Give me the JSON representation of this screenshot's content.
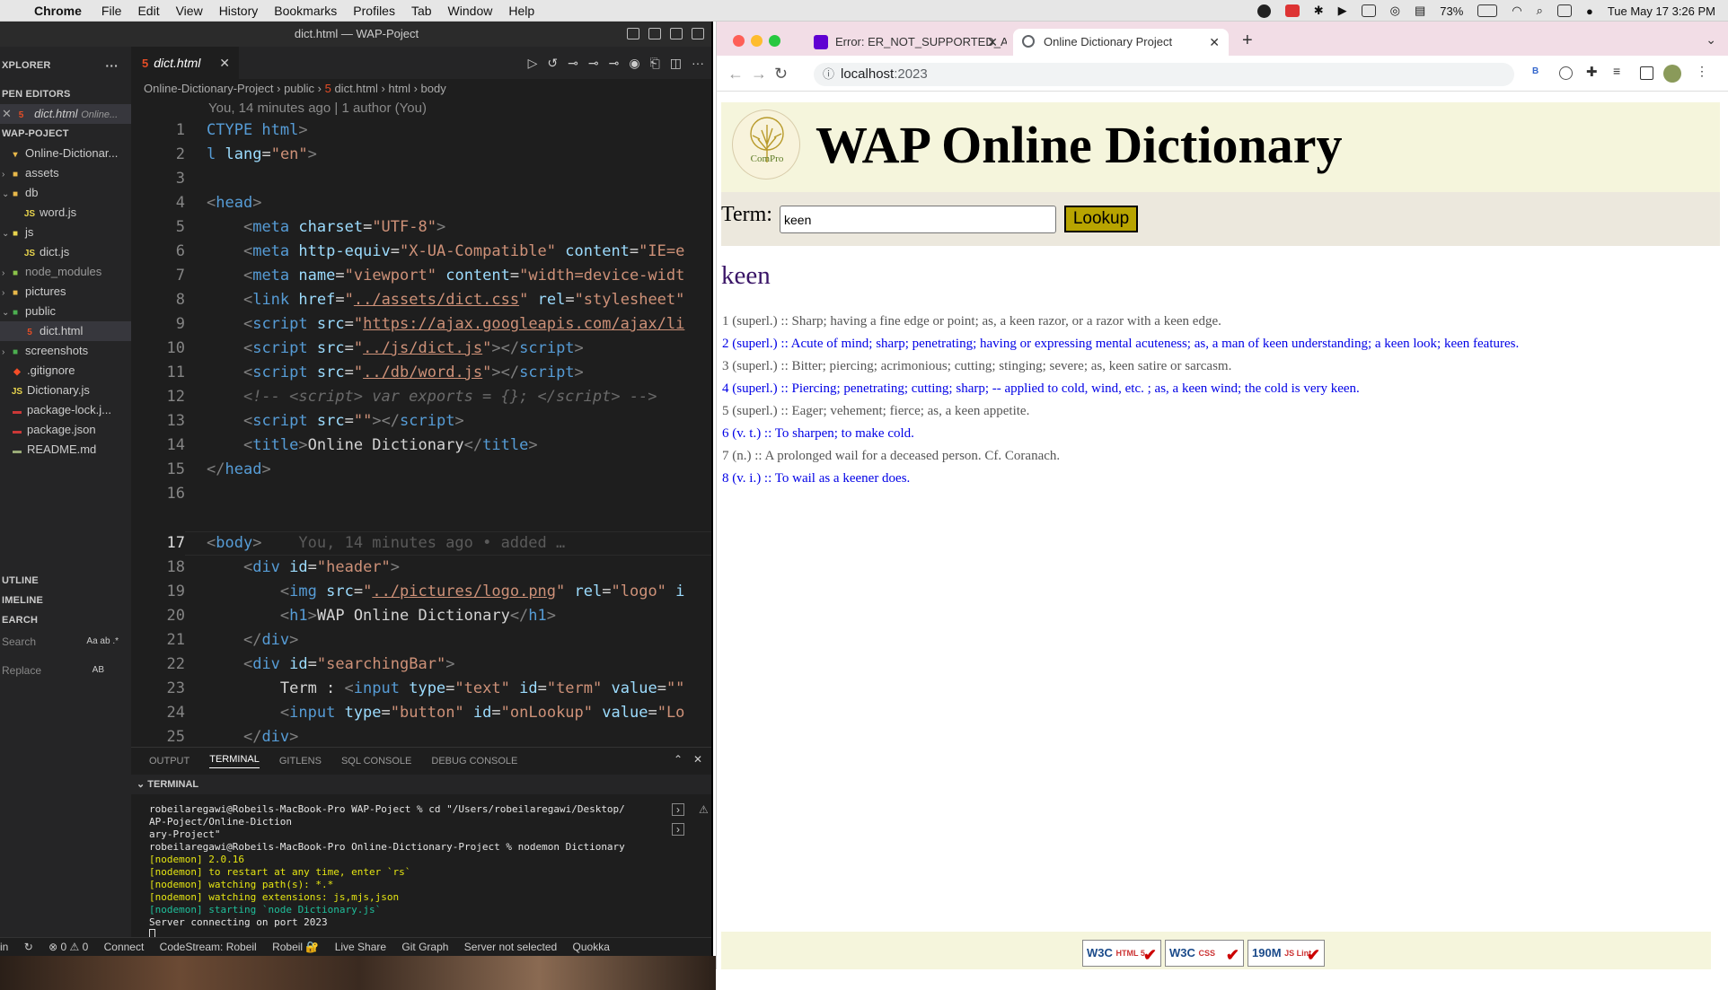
{
  "menubar": {
    "app_name": "Chrome",
    "items": [
      "File",
      "Edit",
      "View",
      "History",
      "Bookmarks",
      "Profiles",
      "Tab",
      "Window",
      "Help"
    ],
    "battery": "73%",
    "clock": "Tue May 17  3:26 PM"
  },
  "vscode": {
    "window_title": "dict.html — WAP-Poject",
    "sidebar": {
      "explorer_label": "XPLORER",
      "open_editors_label": "PEN EDITORS",
      "open_editor_file": "dict.html",
      "open_editor_path": "Online...",
      "project_label": "WAP-POJECT",
      "tree": [
        {
          "name": "Online-Dictionar...",
          "indent": 1
        },
        {
          "name": "assets",
          "indent": 2
        },
        {
          "name": "db",
          "indent": 2
        },
        {
          "name": "word.js",
          "indent": 3
        },
        {
          "name": "js",
          "indent": 2
        },
        {
          "name": "dict.js",
          "indent": 3
        },
        {
          "name": "node_modules",
          "indent": 2
        },
        {
          "name": "pictures",
          "indent": 2
        },
        {
          "name": "public",
          "indent": 2
        },
        {
          "name": "dict.html",
          "indent": 3
        },
        {
          "name": "screenshots",
          "indent": 2
        },
        {
          "name": ".gitignore",
          "indent": 2
        },
        {
          "name": "Dictionary.js",
          "indent": 2
        },
        {
          "name": "package-lock.j...",
          "indent": 2
        },
        {
          "name": "package.json",
          "indent": 2
        },
        {
          "name": "README.md",
          "indent": 2
        }
      ],
      "outline_label": "UTLINE",
      "timeline_label": "IMELINE",
      "search_label": "EARCH",
      "search_placeholder": "Search",
      "replace_placeholder": "Replace",
      "search_opts": "Aa  ab  .*",
      "replace_opts": "AB"
    },
    "tab_label": "dict.html",
    "breadcrumb": [
      "Online-Dictionary-Project",
      "public",
      "dict.html",
      "html",
      "body"
    ],
    "blame": "You, 14 minutes ago | 1 author (You)",
    "line_numbers": [
      "1",
      "2",
      "3",
      "4",
      "5",
      "6",
      "7",
      "8",
      "9",
      "10",
      "11",
      "12",
      "13",
      "14",
      "15",
      "16",
      "17",
      "18",
      "19",
      "20",
      "21",
      "22",
      "23",
      "24",
      "25"
    ],
    "inline_blame": "You, 14 minutes ago • added …",
    "panel_tabs": [
      "OUTPUT",
      "TERMINAL",
      "GITLENS",
      "SQL CONSOLE",
      "DEBUG CONSOLE"
    ],
    "terminal_header": "TERMINAL",
    "terminal_lines": [
      {
        "text": "robeilaregawi@Robeils-MacBook-Pro WAP-Poject % cd \"/Users/robeilaregawi/Desktop/",
        "cls": ""
      },
      {
        "text": "AP-Poject/Online-Diction",
        "cls": ""
      },
      {
        "text": "ary-Project\"",
        "cls": ""
      },
      {
        "text": "robeilaregawi@Robeils-MacBook-Pro Online-Dictionary-Project % nodemon Dictionary",
        "cls": ""
      },
      {
        "text": "[nodemon] 2.0.16",
        "cls": "ty"
      },
      {
        "text": "[nodemon] to restart at any time, enter `rs`",
        "cls": "ty"
      },
      {
        "text": "[nodemon] watching path(s): *.*",
        "cls": "ty"
      },
      {
        "text": "[nodemon] watching extensions: js,mjs,json",
        "cls": "ty"
      },
      {
        "text": "[nodemon] starting `node Dictionary.js`",
        "cls": "tgr"
      },
      {
        "text": "Server connecting on port 2023",
        "cls": ""
      }
    ],
    "statusbar": [
      "in",
      "⊗ 0 ⚠ 0",
      "Connect",
      "CodeStream: Robeil",
      "Robeil 🔐",
      "Live Share",
      "Git Graph",
      "Server not selected",
      "Quokka"
    ]
  },
  "chrome": {
    "tabs": [
      {
        "title": "Error: ER_NOT_SUPPORTED_A",
        "favicon_color": "#6001d2"
      },
      {
        "title": "Online Dictionary Project",
        "favicon_color": "#5f6368"
      }
    ],
    "url_host": "localhost",
    "url_port": ":2023"
  },
  "page": {
    "logo_text": "ComPro",
    "title": "WAP Online Dictionary",
    "term_label": "Term:",
    "term_value": "keen",
    "lookup_label": "Lookup",
    "result_word": "keen",
    "definitions": [
      "1 (superl.) :: Sharp; having a fine edge or point; as, a keen razor, or a razor with a keen edge.",
      "2 (superl.) :: Acute of mind; sharp; penetrating; having or expressing mental acuteness; as, a man of keen understanding; a keen look; keen features.",
      "3 (superl.) :: Bitter; piercing; acrimonious; cutting; stinging; severe; as, keen satire or sarcasm.",
      "4 (superl.) :: Piercing; penetrating; cutting; sharp; -- applied to cold, wind, etc. ; as, a keen wind; the cold is very keen.",
      "5 (superl.) :: Eager; vehement; fierce; as, a keen appetite.",
      "6 (v. t.) :: To sharpen; to make cold.",
      "7 (n.) :: A prolonged wail for a deceased person. Cf. Coranach.",
      "8 (v. i.) :: To wail as a keener does."
    ],
    "badges": [
      {
        "main": "W3C",
        "sub": "HTML 5"
      },
      {
        "main": "W3C",
        "sub": "CSS"
      },
      {
        "main": "190M",
        "sub": "JS Lint"
      }
    ]
  }
}
